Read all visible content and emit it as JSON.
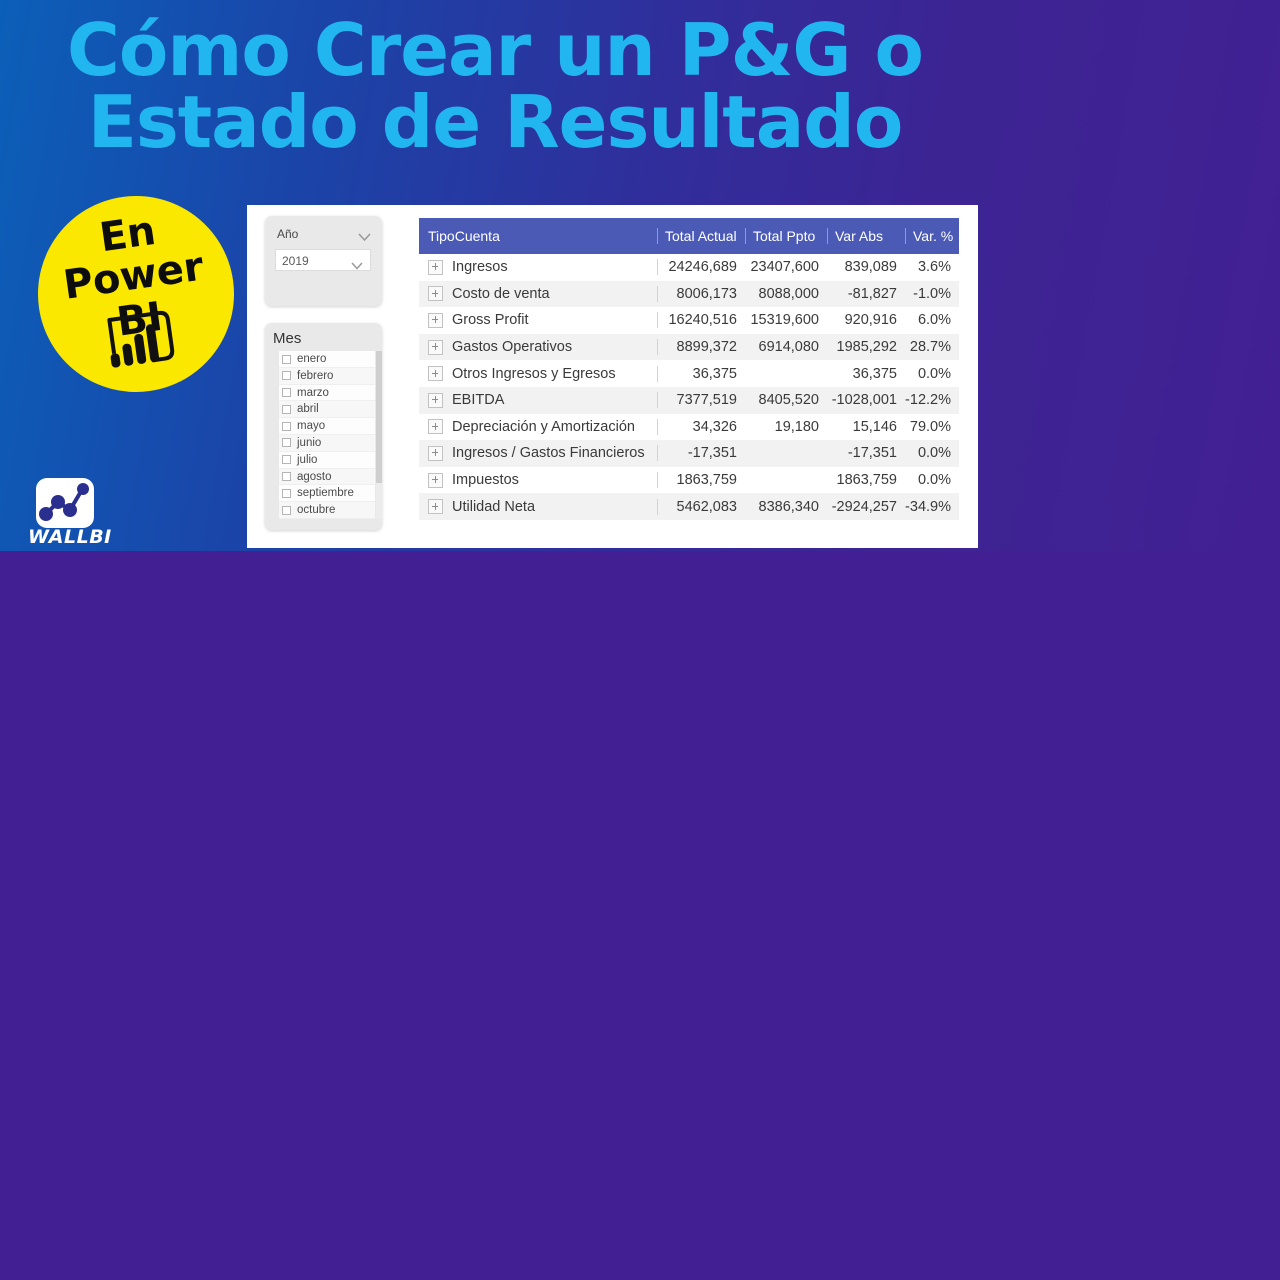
{
  "banner": {
    "title": "Cómo Crear un P&G o\nEstado de Resultado",
    "title_color": "#22b6f0",
    "gradient_from": "#0b5fb8",
    "gradient_to": "#422093"
  },
  "badge": {
    "line1": "En",
    "line2": "Power BI",
    "logo_icon": "power-bi-icon",
    "background_color": "#fbe800",
    "text_color": "#0d0d0d"
  },
  "brand": {
    "name": "WALLBI",
    "mark_icon": "wallbi-network-icon"
  },
  "report": {
    "slicers": {
      "year": {
        "title": "Año",
        "header_chevron_icon": "chevron-down-icon",
        "selected_value": "2019",
        "dropdown_chevron_icon": "chevron-down-icon"
      },
      "month": {
        "title": "Mes",
        "options": [
          "enero",
          "febrero",
          "marzo",
          "abril",
          "mayo",
          "junio",
          "julio",
          "agosto",
          "septiembre",
          "octubre"
        ]
      }
    },
    "matrix": {
      "header_background": "#4b5bb5",
      "columns": [
        "TipoCuenta",
        "Total Actual",
        "Total Ppto",
        "Var Abs",
        "Var. %"
      ],
      "expand_icon": "expand-plus-icon",
      "rows": [
        {
          "label": "Ingresos",
          "total_actual": "24246,689",
          "total_ppto": "23407,600",
          "var_abs": "839,089",
          "var_pct": "3.6%"
        },
        {
          "label": "Costo de venta",
          "total_actual": "8006,173",
          "total_ppto": "8088,000",
          "var_abs": "-81,827",
          "var_pct": "-1.0%"
        },
        {
          "label": "Gross Profit",
          "total_actual": "16240,516",
          "total_ppto": "15319,600",
          "var_abs": "920,916",
          "var_pct": "6.0%"
        },
        {
          "label": "Gastos Operativos",
          "total_actual": "8899,372",
          "total_ppto": "6914,080",
          "var_abs": "1985,292",
          "var_pct": "28.7%"
        },
        {
          "label": "Otros Ingresos y Egresos",
          "total_actual": "36,375",
          "total_ppto": "",
          "var_abs": "36,375",
          "var_pct": "0.0%"
        },
        {
          "label": "EBITDA",
          "total_actual": "7377,519",
          "total_ppto": "8405,520",
          "var_abs": "-1028,001",
          "var_pct": "-12.2%"
        },
        {
          "label": "Depreciación y Amortización",
          "total_actual": "34,326",
          "total_ppto": "19,180",
          "var_abs": "15,146",
          "var_pct": "79.0%"
        },
        {
          "label": "Ingresos / Gastos Financieros",
          "total_actual": "-17,351",
          "total_ppto": "",
          "var_abs": "-17,351",
          "var_pct": "0.0%"
        },
        {
          "label": "Impuestos",
          "total_actual": "1863,759",
          "total_ppto": "",
          "var_abs": "1863,759",
          "var_pct": "0.0%"
        },
        {
          "label": "Utilidad Neta",
          "total_actual": "5462,083",
          "total_ppto": "8386,340",
          "var_abs": "-2924,257",
          "var_pct": "-34.9%"
        }
      ]
    }
  }
}
